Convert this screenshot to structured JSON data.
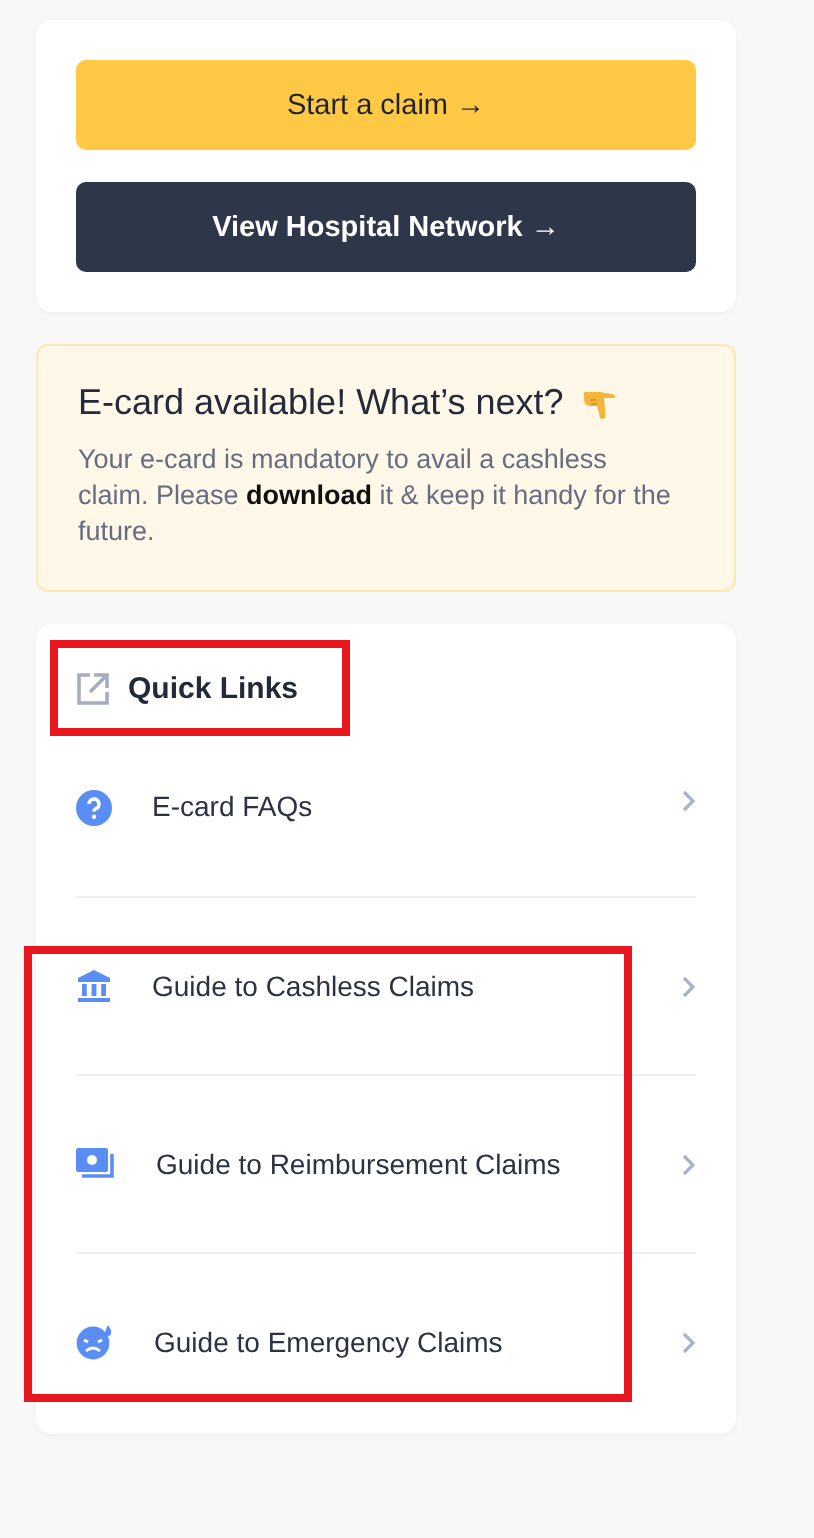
{
  "actions": [
    {
      "label": "Start a claim →",
      "kind": "primary"
    },
    {
      "label": "View Hospital Network →",
      "kind": "dark"
    }
  ],
  "ecard_notice": {
    "title": "E-card available! What’s next?",
    "body": "Your e-card is mandatory to avail a cashless claim. Please **download** it & keep it handy for the future."
  },
  "quick_links": {
    "title": "Quick Links",
    "highlighted": true,
    "items": [
      {
        "label": "E-card FAQs",
        "kind": "question",
        "highlighted": false
      },
      {
        "label": "Guide to Cashless Claims",
        "kind": "bank",
        "highlighted": true
      },
      {
        "label": "Guide to Reimbursement Claims",
        "kind": "cash",
        "highlighted": true
      },
      {
        "label": "Guide to Emergency Claims",
        "kind": "emergency",
        "highlighted": true
      }
    ]
  }
}
